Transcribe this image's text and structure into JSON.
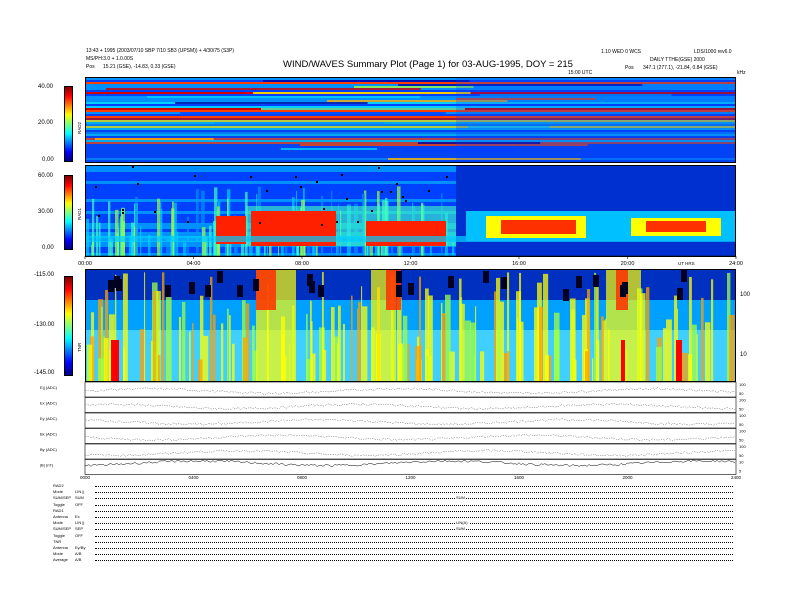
{
  "header": {
    "left1": "13:43 + 1995 (2003/07/10 SBP 7/10 SB3 (UPSM)) + 4/30/75 (S3P)",
    "left2": "MS/PH:3.0 + 1.0.00S",
    "left3_label": "Pos",
    "left3_value": "15.21 (GSE), -14.83, 0.33 (GSE)",
    "title": "WIND/WAVES Summary Plot (Page 1) for 03-AUG-1995, DOY = 215",
    "right1a": "1.10 WED 0 WCS",
    "right1b": "LDS/1000 rev6.0",
    "right2": "DAILY TTHE(GSE) 2000",
    "right3_label": "Pos",
    "right3_value": "347.1 (277.1), -21.84, 0.84 (GSE)",
    "top_time": "15:00 UTC",
    "top_unit": "kHz"
  },
  "rad2": {
    "label": "RAD2",
    "ticks": [
      "40.00",
      "20.00",
      "0.00"
    ],
    "colors": {
      "bg": "#0a4fd8",
      "hot": "#ff1a00",
      "mid": "#00d8ff",
      "warm": "#ffd000"
    }
  },
  "rad1": {
    "label": "RAD1",
    "ticks": [
      "60.00",
      "30.00",
      "0.00"
    ]
  },
  "time_axis": [
    "00:00",
    "04:00",
    "08:00",
    "12:00",
    "16:00",
    "20:00",
    "24:00"
  ],
  "time_axis_right": "UT HRS",
  "tnr": {
    "label": "TNR",
    "ticks": [
      "-115.00",
      "-130.00",
      "-145.00"
    ],
    "right_ticks": [
      "100",
      "10"
    ],
    "right_unit": "kHz"
  },
  "lines": [
    {
      "label": "E|| (ADC)",
      "tick_hi": "100",
      "tick_lo": "50"
    },
    {
      "label": "Ex (ADC)",
      "tick_hi": "100",
      "tick_lo": "50"
    },
    {
      "label": "Ey (ADC)",
      "tick_hi": "100",
      "tick_lo": "50"
    },
    {
      "label": "Bx (ADC)",
      "tick_hi": "100",
      "tick_lo": "50"
    },
    {
      "label": "By (ADC)",
      "tick_hi": "100",
      "tick_lo": "50"
    },
    {
      "label": "|B| (nT)",
      "tick_hi": "10",
      "tick_lo": "5"
    }
  ],
  "bottom_axis": [
    "0000",
    "0400",
    "0800",
    "1200",
    "1600",
    "2000",
    "2400"
  ],
  "footer": [
    {
      "l1": "RAD2",
      "l2": "",
      "mid": ""
    },
    {
      "l1": "Mode",
      "l2": "LIN ||",
      "mid": ""
    },
    {
      "l1": "SUM/SEP",
      "l2": "SUM",
      "mid": "SUM"
    },
    {
      "l1": "Toggle",
      "l2": "OFF",
      "mid": ""
    },
    {
      "l1": "RAD1",
      "l2": "",
      "mid": ""
    },
    {
      "l1": "Antenna",
      "l2": "Ex",
      "mid": ""
    },
    {
      "l1": "Mode",
      "l2": "LIN ||",
      "mid": "LIN(A)"
    },
    {
      "l1": "SUM/SEP",
      "l2": "SEP",
      "mid": "SUM"
    },
    {
      "l1": "Toggle",
      "l2": "OFF",
      "mid": ""
    },
    {
      "l1": "TNR",
      "l2": "",
      "mid": ""
    },
    {
      "l1": "Antenna",
      "l2": "Ey/By",
      "mid": ""
    },
    {
      "l1": "Mode",
      "l2": "A/B",
      "mid": ""
    },
    {
      "l1": "Average",
      "l2": "A/B",
      "mid": ""
    }
  ]
}
